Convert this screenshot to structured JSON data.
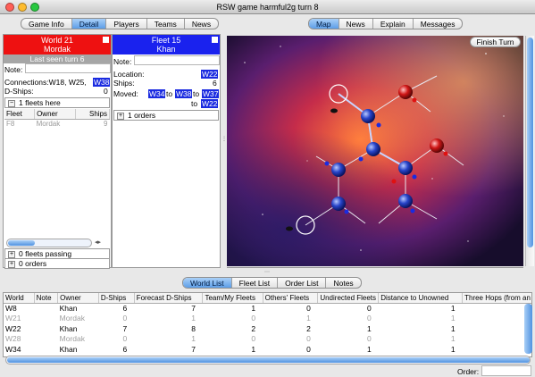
{
  "window": {
    "title": "RSW game harmful2g turn 8"
  },
  "left_tabs": [
    {
      "label": "Game Info",
      "selected": false
    },
    {
      "label": "Detail",
      "selected": true
    },
    {
      "label": "Players",
      "selected": false
    },
    {
      "label": "Teams",
      "selected": false
    },
    {
      "label": "News",
      "selected": false
    }
  ],
  "world_panel": {
    "header_line1": "World 21",
    "header_line2": "Mordak",
    "header_color": "#ee1111",
    "last_seen": "Last seen turn 6",
    "note_label": "Note:",
    "connections_label": "Connections:",
    "connections_plain": "W18, W25,",
    "connections_highlight": "W38",
    "dships_label": "D-Ships:",
    "dships_value": "0",
    "fleets_here": "1 fleets here",
    "fleet_table": {
      "headers": [
        "Fleet",
        "Owner",
        "Ships"
      ],
      "rows": [
        [
          "F8",
          "Mordak",
          "9"
        ]
      ]
    },
    "fleets_passing": "0 fleets passing",
    "orders": "0 orders"
  },
  "fleet_panel": {
    "header_line1": "Fleet 15",
    "header_line2": "Khan",
    "header_color": "#1a22ee",
    "note_label": "Note:",
    "location_label": "Location:",
    "location_value": "W22",
    "ships_label": "Ships:",
    "ships_value": "6",
    "moved_label": "Moved:",
    "moved_path": [
      "W34",
      "to",
      "W38",
      "to",
      "W37",
      "to",
      "W22"
    ],
    "orders": "1 orders"
  },
  "map_tabs": [
    {
      "label": "Map",
      "selected": true
    },
    {
      "label": "News",
      "selected": false
    },
    {
      "label": "Explain",
      "selected": false
    },
    {
      "label": "Messages",
      "selected": false
    }
  ],
  "finish_turn": "Finish Turn",
  "bottom_tabs": [
    {
      "label": "World List",
      "selected": true
    },
    {
      "label": "Fleet List",
      "selected": false
    },
    {
      "label": "Order List",
      "selected": false
    },
    {
      "label": "Notes",
      "selected": false
    }
  ],
  "world_list": {
    "headers": [
      "World",
      "Note",
      "Owner",
      "D-Ships",
      "Forecast D-Ships",
      "Team/My Fleets",
      "Others' Fleets",
      "Undirected Fleets",
      "Distance to Unowned",
      "Three Hops (from an"
    ],
    "rows": [
      {
        "dim": false,
        "cells": [
          "W8",
          "",
          "Khan",
          "6",
          "7",
          "1",
          "0",
          "0",
          "1",
          ""
        ]
      },
      {
        "dim": true,
        "cells": [
          "W21",
          "",
          "Mordak",
          "0",
          "1",
          "0",
          "1",
          "0",
          "1",
          ""
        ]
      },
      {
        "dim": false,
        "cells": [
          "W22",
          "",
          "Khan",
          "7",
          "8",
          "2",
          "2",
          "1",
          "1",
          ""
        ]
      },
      {
        "dim": true,
        "cells": [
          "W28",
          "",
          "Mordak",
          "0",
          "1",
          "0",
          "0",
          "0",
          "1",
          ""
        ]
      },
      {
        "dim": false,
        "cells": [
          "W34",
          "",
          "Khan",
          "6",
          "7",
          "1",
          "0",
          "1",
          "1",
          ""
        ]
      }
    ]
  },
  "order_label": "Order:"
}
